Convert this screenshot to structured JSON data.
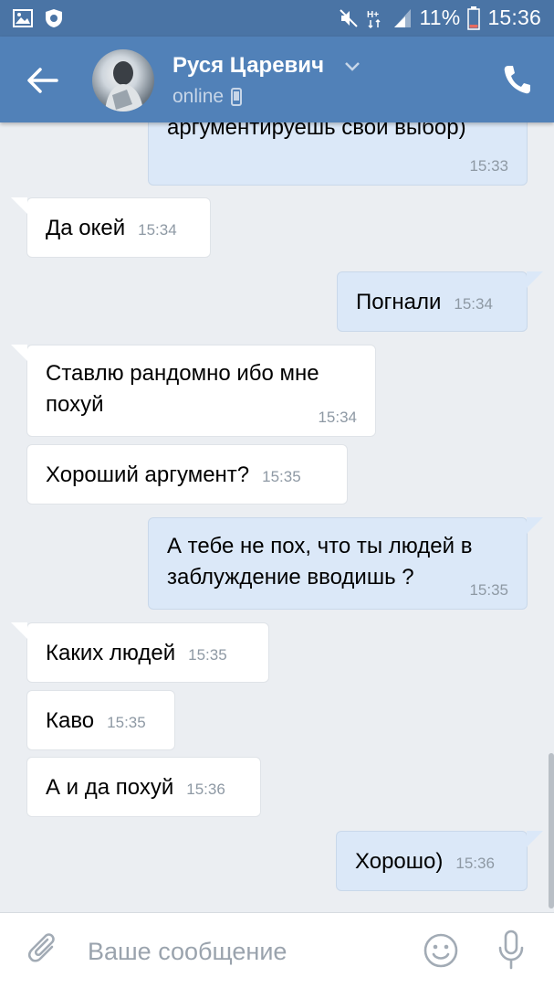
{
  "status_bar": {
    "battery": "11%",
    "time": "15:36",
    "icons": [
      "gallery-icon",
      "shield-icon",
      "mute-icon",
      "network-icon",
      "signal-icon",
      "battery-icon"
    ]
  },
  "header": {
    "contact_name": "Руся Царевич",
    "status": "online",
    "icons": [
      "back-arrow-icon",
      "avatar",
      "chevron-down-icon",
      "mobile-icon",
      "phone-icon"
    ]
  },
  "messages": [
    {
      "dir": "out",
      "text": "аргументируешь свой выбор)",
      "time": "15:33"
    },
    {
      "dir": "in",
      "text": "Да окей",
      "time": "15:34"
    },
    {
      "dir": "out",
      "text": "Погнали",
      "time": "15:34"
    },
    {
      "dir": "in",
      "text": "Ставлю рандомно ибо мне похуй",
      "time": "15:34"
    },
    {
      "dir": "in",
      "text": "Хороший аргумент?",
      "time": "15:35"
    },
    {
      "dir": "out",
      "text": "А тебе не пох, что ты людей в заблуждение вводишь ?",
      "time": "15:35"
    },
    {
      "dir": "in",
      "text": "Каких людей",
      "time": "15:35"
    },
    {
      "dir": "in",
      "text": "Каво",
      "time": "15:35"
    },
    {
      "dir": "in",
      "text": "А и да похуй",
      "time": "15:36"
    },
    {
      "dir": "out",
      "text": "Хорошо)",
      "time": "15:36"
    }
  ],
  "composer": {
    "placeholder": "Ваше сообщение",
    "value": "",
    "icons": [
      "paperclip-icon",
      "emoji-icon",
      "microphone-icon"
    ]
  },
  "colors": {
    "status_bar": "#4a74a5",
    "header": "#5181b8",
    "background": "#ebeef2",
    "incoming_bubble": "#ffffff",
    "outgoing_bubble": "#dbe8f8"
  }
}
